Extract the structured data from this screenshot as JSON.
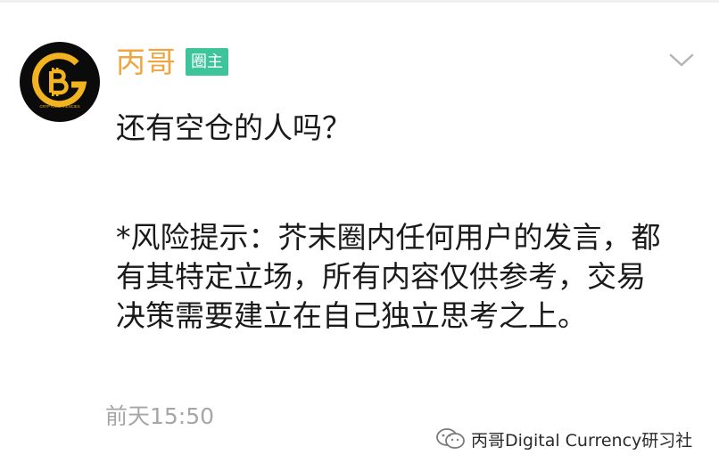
{
  "post": {
    "author": {
      "name": "丙哥",
      "role_badge": "圈主",
      "avatar_text": "CRYPTOCURRENCIES"
    },
    "content": "还有空仓的人吗？",
    "risk_notice": "*风险提示：芥末圈内任何用户的发言，都有其特定立场，所有内容仅供参考，交易决策需要建立在自己独立思考之上。",
    "timestamp": "前天15:50"
  },
  "watermark": {
    "text": "丙哥Digital Currency研习社",
    "icon": "wechat-official-account-icon"
  },
  "icons": {
    "expand": "chevron-down-icon",
    "avatar_logo": "bitcoin-logo-icon"
  },
  "colors": {
    "username": "#f0a540",
    "badge_bg": "#3dc49a",
    "avatar_gold": "#f2b320",
    "timestamp": "#a6a6a6"
  }
}
